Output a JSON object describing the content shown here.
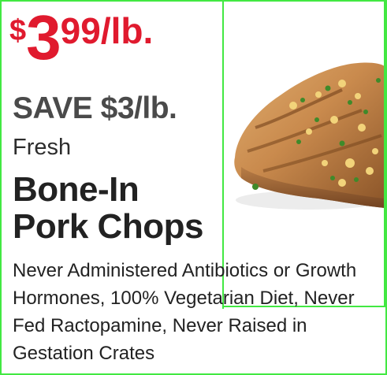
{
  "ad": {
    "price_dollar_sign": "$",
    "price_main": "3",
    "price_cents": "99",
    "price_unit": "/lb.",
    "save_text": "SAVE $3/lb.",
    "freshness": "Fresh",
    "product_line1": "Bone-In",
    "product_line2": "Pork Chops",
    "description": "Never Administered Antibiotics or Growth Hormones, 100% Vegetarian Diet, Never Fed Ractopamine, Never Raised in Gestation Crates",
    "product_image_icon": "pork-chop-photo"
  },
  "colors": {
    "price_red": "#e01a2e",
    "save_gray": "#4a4a4a",
    "text_dark": "#222222",
    "outline_green": "#42e842"
  }
}
